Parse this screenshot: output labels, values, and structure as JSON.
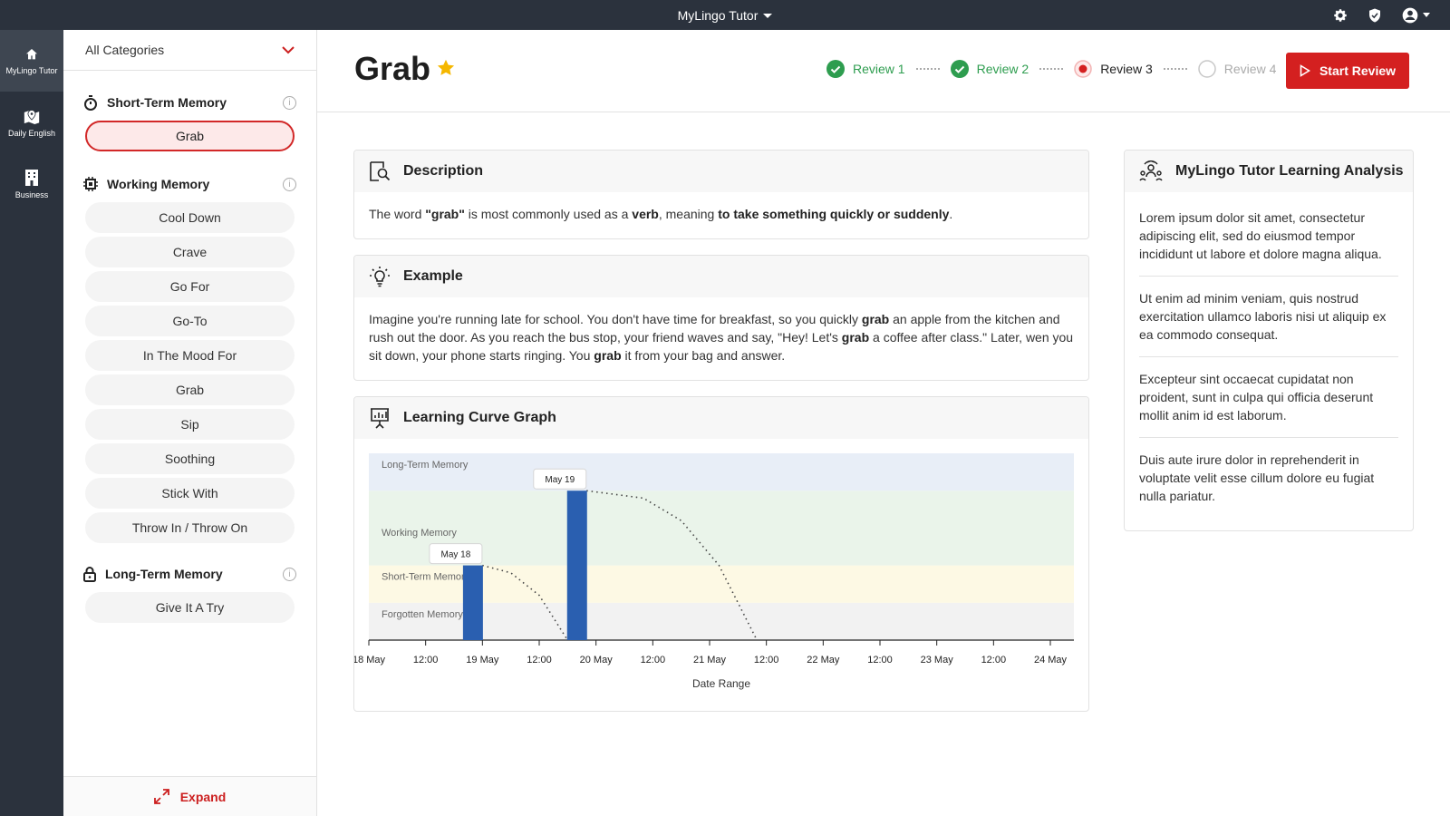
{
  "topbar": {
    "app_title": "MyLingo Tutor",
    "icons": [
      "gear-icon",
      "check-shield-icon",
      "account-icon"
    ]
  },
  "rail": {
    "items": [
      {
        "label": "MyLingo Tutor",
        "icon": "home-icon",
        "active": true
      },
      {
        "label": "Daily English",
        "icon": "map-icon",
        "active": false
      },
      {
        "label": "Business",
        "icon": "building-icon",
        "active": false
      }
    ]
  },
  "sidebar": {
    "category_select": "All Categories",
    "sections": {
      "short_term": {
        "title": "Short-Term Memory",
        "items": [
          "Grab"
        ]
      },
      "working": {
        "title": "Working Memory",
        "items": [
          "Cool Down",
          "Crave",
          "Go For",
          "Go-To",
          "In The Mood For",
          "Grab",
          "Sip",
          "Soothing",
          "Stick With",
          "Throw In / Throw On"
        ]
      },
      "long_term": {
        "title": "Long-Term Memory",
        "items": [
          "Give It A Try"
        ]
      }
    },
    "info_glyph": "i",
    "expand_label": "Expand"
  },
  "header": {
    "word": "Grab",
    "favorite": true,
    "steps": [
      {
        "label": "Review 1",
        "state": "done"
      },
      {
        "label": "Review 2",
        "state": "done"
      },
      {
        "label": "Review 3",
        "state": "current"
      },
      {
        "label": "Review 4",
        "state": "todo"
      }
    ],
    "start_button": "Start Review"
  },
  "description": {
    "title": "Description",
    "text_parts": [
      "The word ",
      "\"grab\"",
      " is most commonly used as a ",
      "verb",
      ", meaning ",
      "to take something quickly or suddenly",
      "."
    ]
  },
  "example": {
    "title": "Example",
    "text_parts": [
      "Imagine you're running late for school. You don't have time for breakfast, so you quickly ",
      "grab",
      " an apple from the kitchen and rush out the door. As you reach the bus stop, your friend waves and say, \"Hey! Let's ",
      "grab",
      " a coffee after class.\" Later, wen you sit down, your phone starts ringing. You ",
      "grab",
      " it from your bag and answer."
    ]
  },
  "graph_card": {
    "title": "Learning Curve Graph"
  },
  "analysis": {
    "title": "MyLingo Tutor Learning Analysis",
    "paragraphs": [
      "Lorem ipsum dolor sit amet, consectetur adipiscing elit, sed do eiusmod tempor incididunt ut labore et dolore magna aliqua.",
      "Ut enim ad minim veniam, quis nostrud exercitation ullamco laboris nisi ut aliquip ex ea commodo consequat.",
      "Excepteur sint occaecat cupidatat non proident, sunt in culpa qui officia deserunt mollit anim id est laborum.",
      "Duis aute irure dolor in reprehenderit in voluptate velit esse cillum dolore eu fugiat nulla pariatur."
    ]
  },
  "colors": {
    "accent": "#d42020",
    "done": "#2e9d4f",
    "rail": "#2b323d",
    "bar": "#2a5fb0",
    "band_long": "#e8eef7",
    "band_working": "#eaf4ea",
    "band_short": "#fdf9e4",
    "band_forgotten": "#f2f2f2"
  },
  "chart_data": {
    "type": "bar",
    "xlabel": "Date Range",
    "x_ticks": [
      "18 May",
      "12:00",
      "19 May",
      "12:00",
      "20 May",
      "12:00",
      "21 May",
      "12:00",
      "22 May",
      "12:00",
      "23 May",
      "12:00",
      "24 May"
    ],
    "x_range_hours": [
      0,
      144
    ],
    "bands": [
      {
        "name": "Forgotten Memory",
        "from": 0,
        "to": 1
      },
      {
        "name": "Short-Term Memory",
        "from": 1,
        "to": 2
      },
      {
        "name": "Working Memory",
        "from": 2,
        "to": 4
      },
      {
        "name": "Long-Term Memory",
        "from": 4,
        "to": 5
      }
    ],
    "y_range": [
      0,
      5
    ],
    "bars": [
      {
        "label": "May 18",
        "x_hours": 22,
        "value": 2
      },
      {
        "label": "May 19",
        "x_hours": 44,
        "value": 4
      }
    ],
    "decay_curves": [
      {
        "points": [
          [
            24,
            2
          ],
          [
            30,
            1.8
          ],
          [
            36,
            1.2
          ],
          [
            42,
            0
          ]
        ]
      },
      {
        "points": [
          [
            46,
            4
          ],
          [
            58,
            3.8
          ],
          [
            66,
            3.2
          ],
          [
            74,
            2
          ],
          [
            82,
            0
          ]
        ]
      }
    ]
  }
}
